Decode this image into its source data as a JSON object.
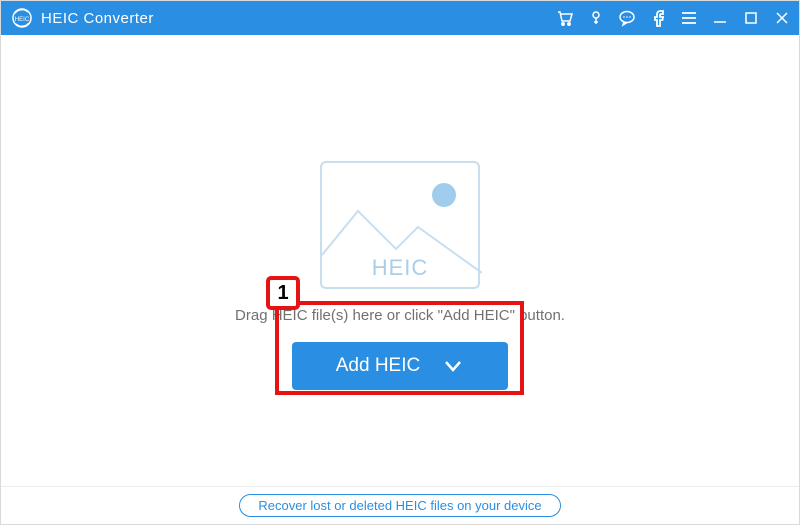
{
  "header": {
    "app_title": "HEIC Converter",
    "icons": {
      "cart": "cart-icon",
      "key": "key-icon",
      "feedback": "speech-icon",
      "facebook": "facebook-icon",
      "menu": "menu-icon",
      "minimize": "minimize-icon",
      "maximize": "maximize-icon",
      "close": "close-icon"
    }
  },
  "main": {
    "illustration_label": "HEIC",
    "hint_text": "Drag HEIC file(s) here or click \"Add HEIC\" button.",
    "add_button_label": "Add HEIC"
  },
  "footer": {
    "recover_link": "Recover lost or deleted HEIC files on your device"
  },
  "annotation": {
    "callout_number": "1"
  },
  "colors": {
    "accent": "#2a8fe2",
    "highlight": "#e51313"
  }
}
